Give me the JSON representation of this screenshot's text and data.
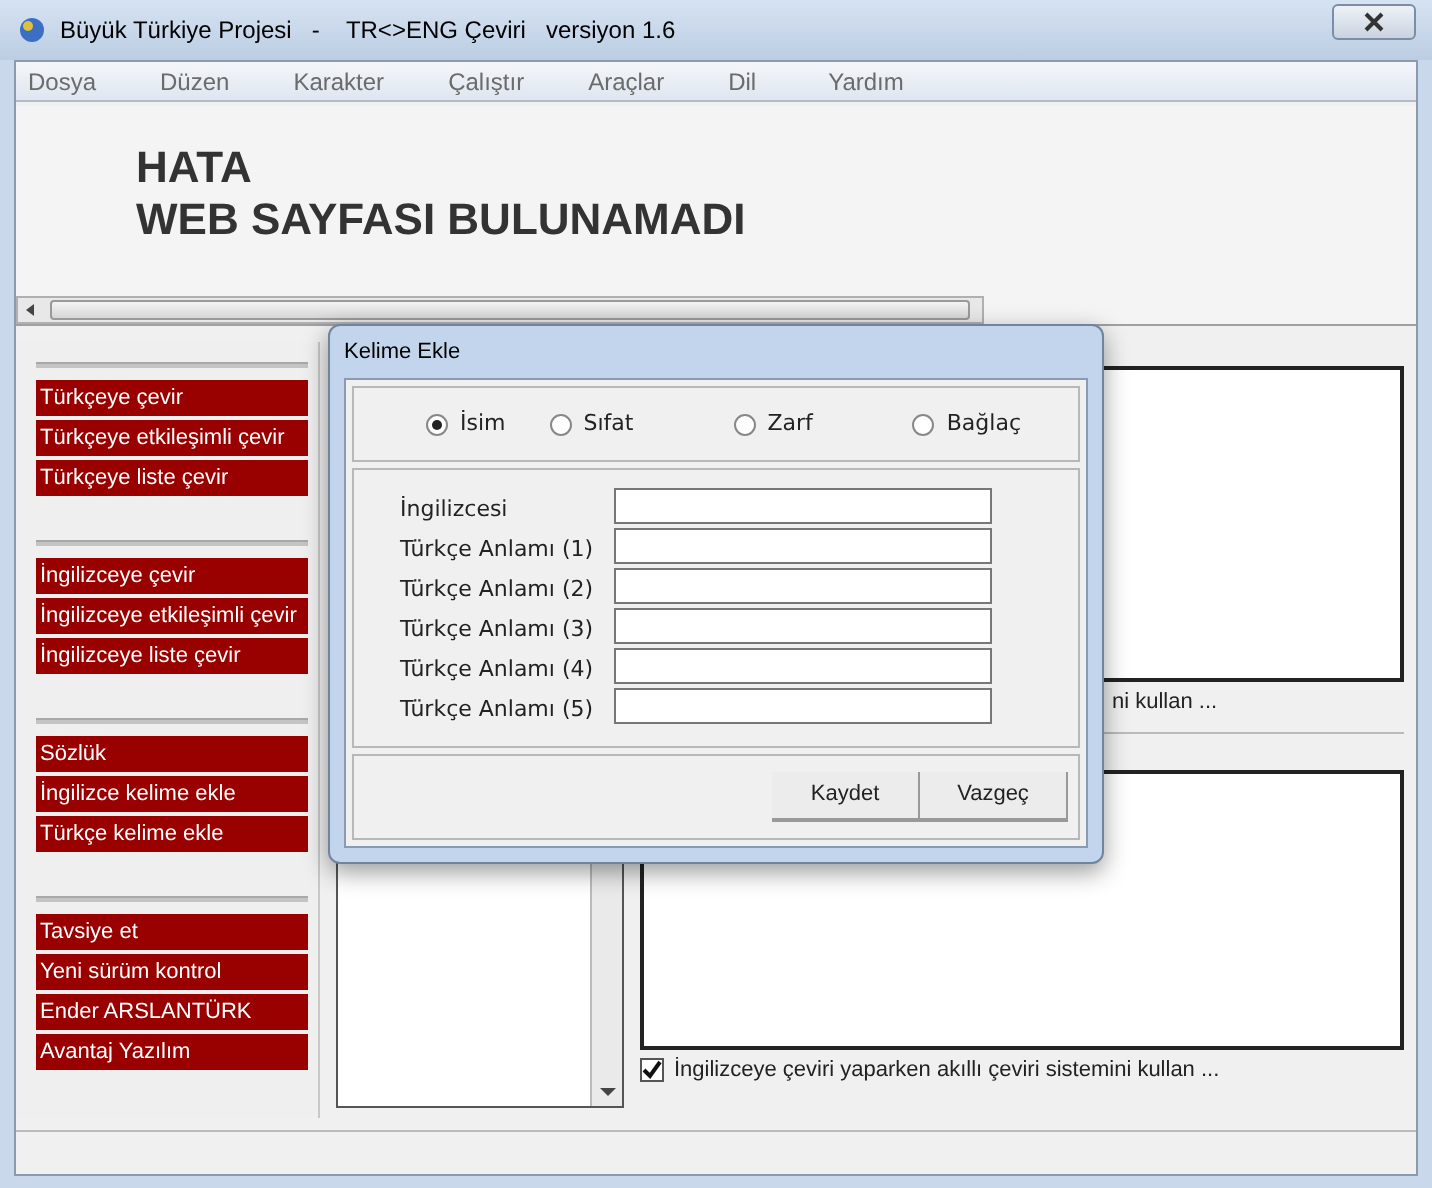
{
  "window": {
    "title": "Büyük Türkiye Projesi   -    TR<>ENG Çeviri   versiyon 1.6"
  },
  "menu": [
    "Dosya",
    "Düzen",
    "Karakter",
    "Çalıştır",
    "Araçlar",
    "Dil",
    "Yardım"
  ],
  "browser": {
    "heading_lines": [
      "HATA",
      "WEB SAYFASI BULUNAMADI"
    ]
  },
  "sidebar": {
    "groups": [
      {
        "items": [
          "Türkçeye çevir",
          "Türkçeye etkileşimli çevir",
          "Türkçeye liste çevir"
        ]
      },
      {
        "items": [
          "İngilizceye çevir",
          "İngilizceye etkileşimli çevir",
          "İngilizceye liste çevir"
        ]
      },
      {
        "items": [
          "Sözlük",
          "İngilizce kelime ekle",
          "Türkçe kelime ekle"
        ]
      },
      {
        "items": [
          "Tavsiye et",
          "Yeni sürüm kontrol",
          "Ender ARSLANTÜRK",
          "Avantaj Yazılım"
        ]
      }
    ]
  },
  "upper_panel": {
    "option_text": "ni kullan ..."
  },
  "lower_panel": {
    "option": {
      "label": "İngilizceye çeviri yaparken akıllı çeviri sistemini kullan ...",
      "checked": true
    }
  },
  "dialog": {
    "title": "Kelime Ekle",
    "word_types": [
      {
        "label": "İsim",
        "selected": true
      },
      {
        "label": "Sıfat",
        "selected": false
      },
      {
        "label": "Zarf",
        "selected": false
      },
      {
        "label": "Bağlaç",
        "selected": false
      }
    ],
    "fields": [
      {
        "label": "İngilizcesi"
      },
      {
        "label": "Türkçe Anlamı (1)"
      },
      {
        "label": "Türkçe Anlamı (2)"
      },
      {
        "label": "Türkçe Anlamı (3)"
      },
      {
        "label": "Türkçe Anlamı (4)"
      },
      {
        "label": "Türkçe Anlamı (5)"
      }
    ],
    "buttons": [
      "Kaydet",
      "Vazgeç"
    ]
  }
}
